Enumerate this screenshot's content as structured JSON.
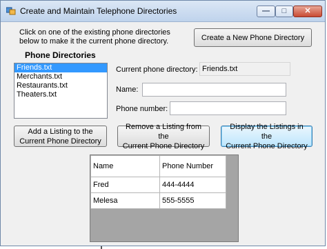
{
  "window": {
    "title": "Create and Maintain Telephone Directories",
    "minimize_glyph": "—",
    "maximize_glyph": "□",
    "close_glyph": "✕"
  },
  "instructions": {
    "line1": "Click on one of the existing phone directories",
    "line2": "below to make it the current phone directory."
  },
  "buttons": {
    "create": "Create a New Phone Directory",
    "add_line1": "Add a Listing to the",
    "add_line2": "Current Phone Directory",
    "remove_line1": "Remove a Listing from the",
    "remove_line2": "Current Phone Directory",
    "display_line1": "Display the Listings in the",
    "display_line2": "Current Phone Directory"
  },
  "directories": {
    "heading": "Phone Directories",
    "items": [
      "Friends.txt",
      "Merchants.txt",
      "Restaurants.txt",
      "Theaters.txt"
    ],
    "selected_index": 0
  },
  "form": {
    "current_label": "Current phone directory:",
    "current_value": "Friends.txt",
    "name_label": "Name:",
    "name_value": "",
    "phone_label": "Phone number:",
    "phone_value": ""
  },
  "grid": {
    "headers": [
      "Name",
      "Phone Number"
    ],
    "rows": [
      [
        "Fred",
        "444-4444"
      ],
      [
        "Melesa",
        "555-5555"
      ]
    ]
  }
}
